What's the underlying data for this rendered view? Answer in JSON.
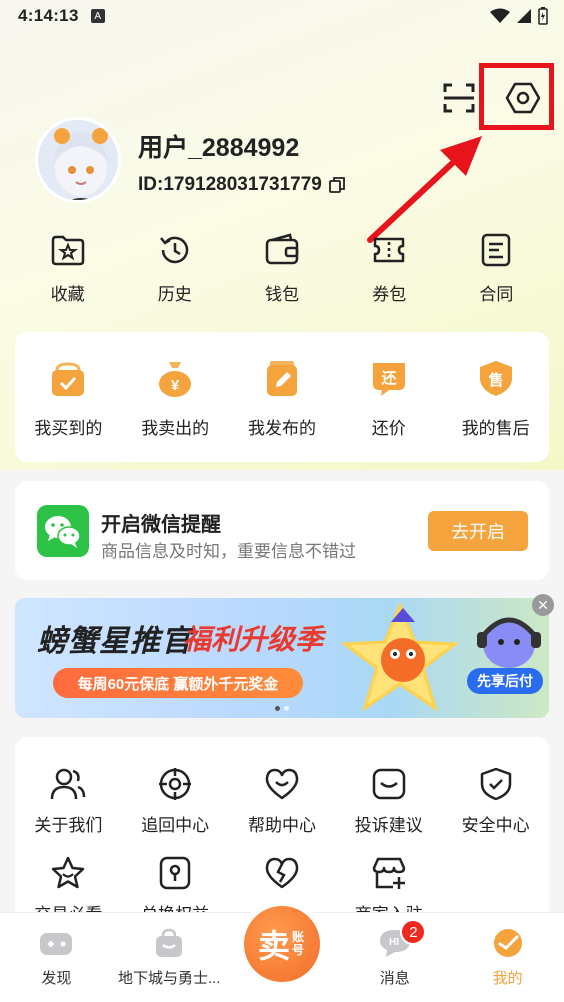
{
  "status_bar": {
    "time": "4:14:13",
    "notif_letter": "A"
  },
  "profile": {
    "username": "用户_2884992",
    "id_text": "ID:179128031731779"
  },
  "quick_actions": [
    "收藏",
    "历史",
    "钱包",
    "券包",
    "合同"
  ],
  "orders": [
    "我买到的",
    "我卖出的",
    "我发布的",
    "还价",
    "我的售后"
  ],
  "order_icon_glyphs": [
    "",
    "¥",
    "",
    "还",
    "售"
  ],
  "wechat": {
    "title": "开启微信提醒",
    "subtitle": "商品信息及时知，重要信息不错过",
    "button": "去开启"
  },
  "banner": {
    "title_part1": "螃蟹星推官",
    "title_part2": "福利升级季",
    "pill_text": "每周60元保底  赢额外千元奖金",
    "tag_text": "先享后付"
  },
  "services": [
    "关于我们",
    "追回中心",
    "帮助中心",
    "投诉建议",
    "安全中心",
    "交易必看",
    "兑换权益",
    "",
    "商家入驻"
  ],
  "bottom_nav": {
    "items": [
      "发现",
      "地下城与勇士...",
      "",
      "消息",
      "我的"
    ],
    "sell_big": "卖",
    "sell_small": "账号",
    "message_badge": "2"
  },
  "colors": {
    "accent": "#f5a33c",
    "highlight": "#e8141b",
    "wechat_green": "#2cc246"
  }
}
